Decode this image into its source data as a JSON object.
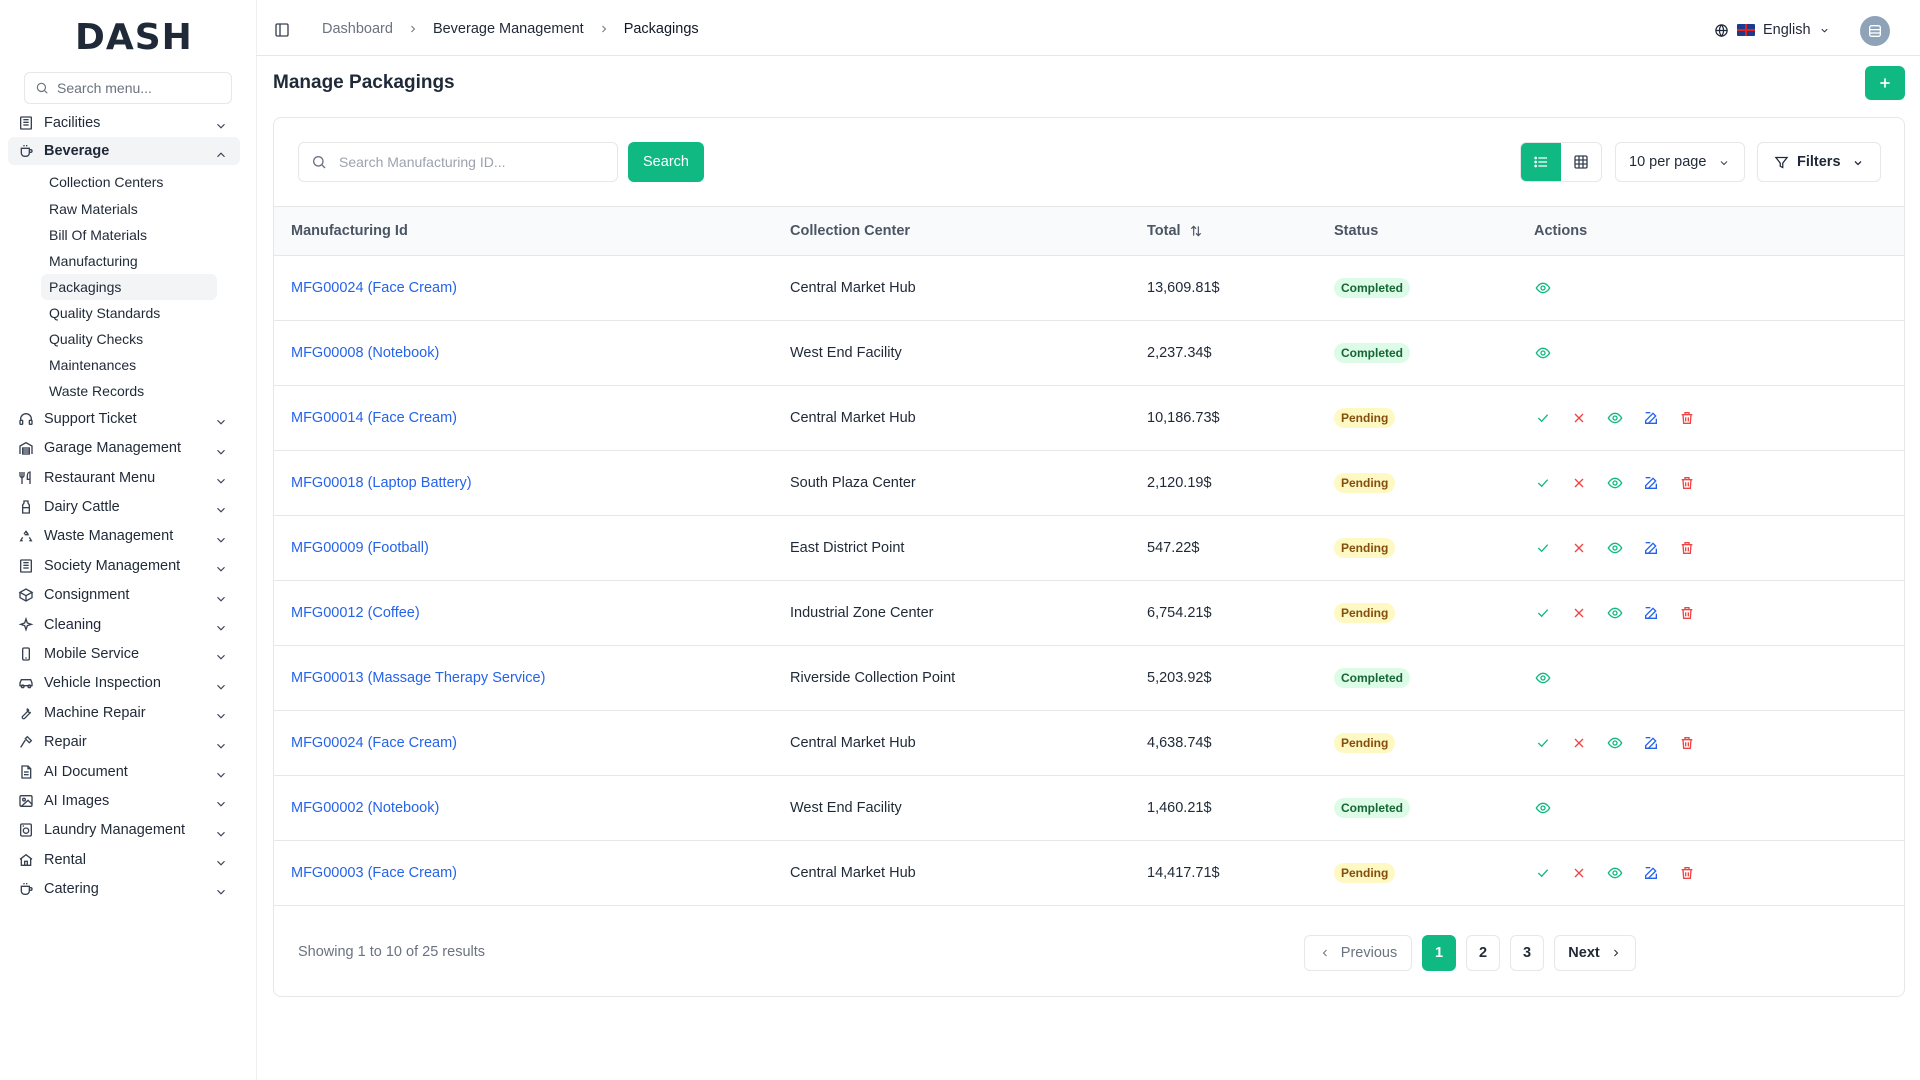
{
  "app": {
    "logo": "DASH"
  },
  "sidebar": {
    "search_placeholder": "Search menu...",
    "items": [
      {
        "label": "Facilities",
        "icon": "building-icon",
        "open": false
      },
      {
        "label": "Beverage",
        "icon": "cup-icon",
        "open": true,
        "children": [
          {
            "label": "Collection Centers",
            "active": false
          },
          {
            "label": "Raw Materials",
            "active": false
          },
          {
            "label": "Bill Of Materials",
            "active": false
          },
          {
            "label": "Manufacturing",
            "active": false
          },
          {
            "label": "Packagings",
            "active": true
          },
          {
            "label": "Quality Standards",
            "active": false
          },
          {
            "label": "Quality Checks",
            "active": false
          },
          {
            "label": "Maintenances",
            "active": false
          },
          {
            "label": "Waste Records",
            "active": false
          }
        ]
      },
      {
        "label": "Support Ticket",
        "icon": "headset-icon",
        "open": false
      },
      {
        "label": "Garage Management",
        "icon": "garage-icon",
        "open": false
      },
      {
        "label": "Restaurant Menu",
        "icon": "utensils-icon",
        "open": false
      },
      {
        "label": "Dairy Cattle",
        "icon": "milk-icon",
        "open": false
      },
      {
        "label": "Waste Management",
        "icon": "recycle-icon",
        "open": false
      },
      {
        "label": "Society Management",
        "icon": "building-icon",
        "open": false
      },
      {
        "label": "Consignment",
        "icon": "package-icon",
        "open": false
      },
      {
        "label": "Cleaning",
        "icon": "sparkle-icon",
        "open": false
      },
      {
        "label": "Mobile Service",
        "icon": "phone-icon",
        "open": false
      },
      {
        "label": "Vehicle Inspection",
        "icon": "car-icon",
        "open": false
      },
      {
        "label": "Machine Repair",
        "icon": "wrench-icon",
        "open": false
      },
      {
        "label": "Repair",
        "icon": "hammer-icon",
        "open": false
      },
      {
        "label": "AI Document",
        "icon": "document-icon",
        "open": false
      },
      {
        "label": "AI Images",
        "icon": "image-icon",
        "open": false
      },
      {
        "label": "Laundry Management",
        "icon": "washer-icon",
        "open": false
      },
      {
        "label": "Rental",
        "icon": "home-icon",
        "open": false
      },
      {
        "label": "Catering",
        "icon": "cup-icon",
        "open": false
      }
    ]
  },
  "header": {
    "breadcrumb": [
      "Dashboard",
      "Beverage Management",
      "Packagings"
    ],
    "language": "English"
  },
  "main": {
    "title": "Manage Packagings",
    "search_placeholder": "Search Manufacturing ID...",
    "search_button": "Search",
    "per_page": "10 per page",
    "filters": "Filters",
    "columns": [
      "Manufacturing Id",
      "Collection Center",
      "Total",
      "Status",
      "Actions"
    ],
    "rows": [
      {
        "id": "MFG00024 (Face Cream)",
        "center": "Central Market Hub",
        "total": "13,609.81$",
        "status": "Completed"
      },
      {
        "id": "MFG00008 (Notebook)",
        "center": "West End Facility",
        "total": "2,237.34$",
        "status": "Completed"
      },
      {
        "id": "MFG00014 (Face Cream)",
        "center": "Central Market Hub",
        "total": "10,186.73$",
        "status": "Pending"
      },
      {
        "id": "MFG00018 (Laptop Battery)",
        "center": "South Plaza Center",
        "total": "2,120.19$",
        "status": "Pending"
      },
      {
        "id": "MFG00009 (Football)",
        "center": "East District Point",
        "total": "547.22$",
        "status": "Pending"
      },
      {
        "id": "MFG00012 (Coffee)",
        "center": "Industrial Zone Center",
        "total": "6,754.21$",
        "status": "Pending"
      },
      {
        "id": "MFG00013 (Massage Therapy Service)",
        "center": "Riverside Collection Point",
        "total": "5,203.92$",
        "status": "Completed"
      },
      {
        "id": "MFG00024 (Face Cream)",
        "center": "Central Market Hub",
        "total": "4,638.74$",
        "status": "Pending"
      },
      {
        "id": "MFG00002 (Notebook)",
        "center": "West End Facility",
        "total": "1,460.21$",
        "status": "Completed"
      },
      {
        "id": "MFG00003 (Face Cream)",
        "center": "Central Market Hub",
        "total": "14,417.71$",
        "status": "Pending"
      }
    ],
    "footer": {
      "showing": "Showing 1 to 10 of 25 results",
      "previous": "Previous",
      "pages": [
        "1",
        "2",
        "3"
      ],
      "current_page": "1",
      "next": "Next"
    }
  },
  "colors": {
    "accent": "#10b981",
    "link": "#2563eb",
    "danger": "#ef4444"
  }
}
